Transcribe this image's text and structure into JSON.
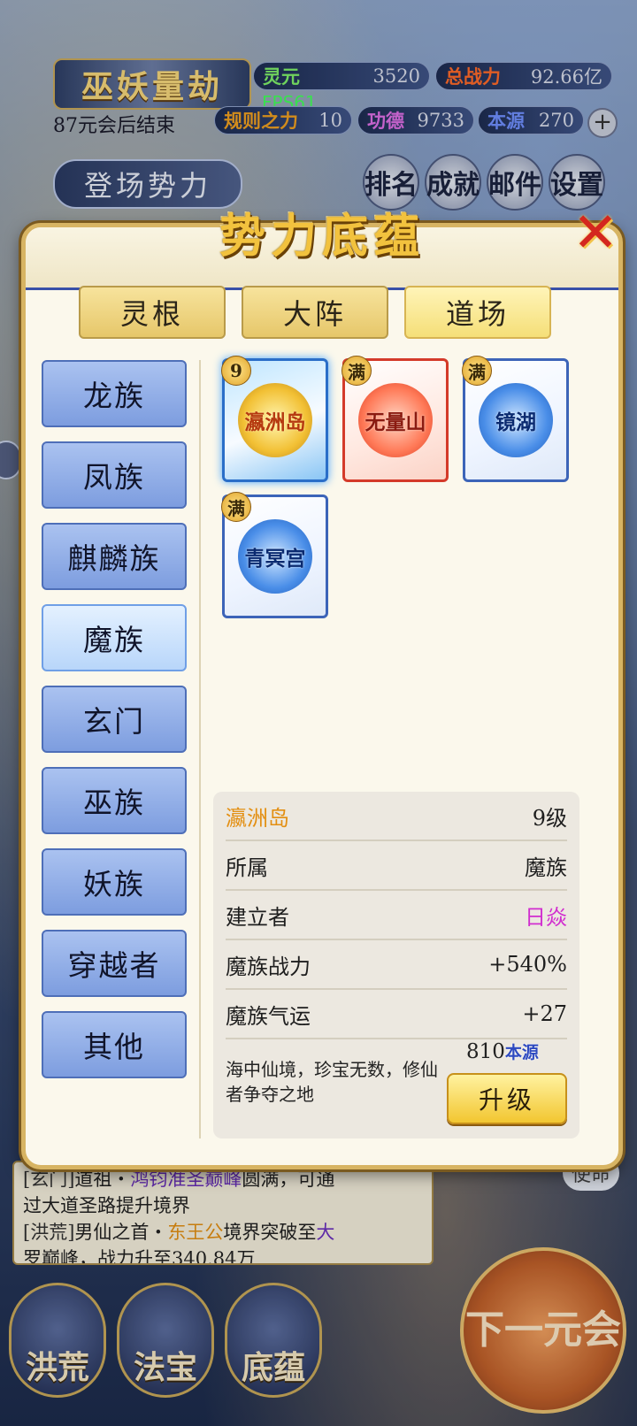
{
  "header": {
    "title": "巫妖量劫",
    "countdown": "87元会后结束",
    "fps": "FPS61",
    "stats": [
      {
        "label": "灵元",
        "value": "3520",
        "color": "#7ff06a"
      },
      {
        "label": "总战力",
        "value": "92.66亿",
        "color": "#ff6a2a"
      },
      {
        "label": "规则之力",
        "value": "10",
        "color": "#f0a020"
      },
      {
        "label": "功德",
        "value": "9733",
        "color": "#e070e8"
      },
      {
        "label": "本源",
        "value": "270",
        "color": "#7090ff"
      }
    ],
    "faction_banner": "登场势力",
    "buttons": [
      {
        "label": "排名"
      },
      {
        "label": "成就"
      },
      {
        "label": "邮件"
      },
      {
        "label": "设置"
      }
    ]
  },
  "log": {
    "line1_tag": "[玄门]",
    "line1_name": "道祖",
    "line1_sep": "・",
    "line1_hl": "鸿钧准圣巅峰",
    "line1_rest": "圆满，可通",
    "line2": "过大道圣路提升境界",
    "line3_tag": "[洪荒]",
    "line3_text": "男仙之首・",
    "line3_hl": "东王公",
    "line3_rest": "境界突破至",
    "line3_hl2": "大",
    "line4": "罗巅峰，战力升至340.84万"
  },
  "side_tag": "使命",
  "bottom_nav": [
    {
      "label": "洪荒"
    },
    {
      "label": "法宝"
    },
    {
      "label": "底蕴"
    }
  ],
  "next_button": "下一元会",
  "modal": {
    "title": "势力底蕴",
    "tabs": [
      {
        "label": "灵根"
      },
      {
        "label": "大阵"
      },
      {
        "label": "道场"
      }
    ],
    "active_tab": "道场",
    "factions": [
      {
        "label": "龙族"
      },
      {
        "label": "凤族"
      },
      {
        "label": "麒麟族"
      },
      {
        "label": "魔族"
      },
      {
        "label": "玄门"
      },
      {
        "label": "巫族"
      },
      {
        "label": "妖族"
      },
      {
        "label": "穿越者"
      },
      {
        "label": "其他"
      }
    ],
    "active_faction": "魔族",
    "cards": [
      {
        "name": "瀛洲岛",
        "badge": "9",
        "style": "gold"
      },
      {
        "name": "无量山",
        "badge": "满",
        "style": "red"
      },
      {
        "name": "镜湖",
        "badge": "满",
        "style": "blue"
      },
      {
        "name": "青冥宫",
        "badge": "满",
        "style": "blue"
      }
    ],
    "info": {
      "name": "瀛洲岛",
      "level": "9级",
      "rows": [
        {
          "label": "所属",
          "value": "魔族"
        },
        {
          "label": "建立者",
          "value": "日焱"
        },
        {
          "label": "魔族战力",
          "value": "+540%"
        },
        {
          "label": "魔族气运",
          "value": "+27"
        }
      ],
      "description": "海中仙境，珍宝无数，修仙者争夺之地",
      "cost_value": "810",
      "cost_unit": "本源",
      "upgrade_label": "升级"
    }
  }
}
